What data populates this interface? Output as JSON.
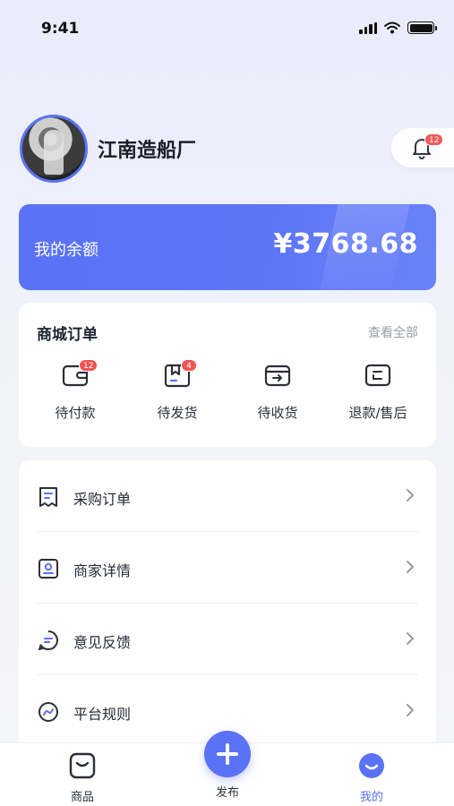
{
  "status_bar": {
    "time": "9:41"
  },
  "profile": {
    "name": "江南造船厂"
  },
  "notifications": {
    "badge": "12"
  },
  "balance": {
    "label": "我的余额",
    "value": "¥3768.68"
  },
  "orders": {
    "title": "商城订单",
    "view_all": "查看全部",
    "items": [
      {
        "label": "待付款",
        "icon": "wallet-icon",
        "badge": "12"
      },
      {
        "label": "待发货",
        "icon": "package-icon",
        "badge": "4"
      },
      {
        "label": "待收货",
        "icon": "receive-icon",
        "badge": ""
      },
      {
        "label": "退款/售后",
        "icon": "refund-icon",
        "badge": ""
      }
    ]
  },
  "menu": [
    {
      "label": "采购订单",
      "icon": "purchase-order-icon"
    },
    {
      "label": "商家详情",
      "icon": "merchant-icon"
    },
    {
      "label": "意见反馈",
      "icon": "feedback-icon"
    },
    {
      "label": "平台规则",
      "icon": "rules-icon"
    }
  ],
  "tabbar": {
    "goods": "商品",
    "publish": "发布",
    "mine": "我的"
  },
  "colors": {
    "accent": "#5a72f6",
    "badge": "#f15353"
  }
}
